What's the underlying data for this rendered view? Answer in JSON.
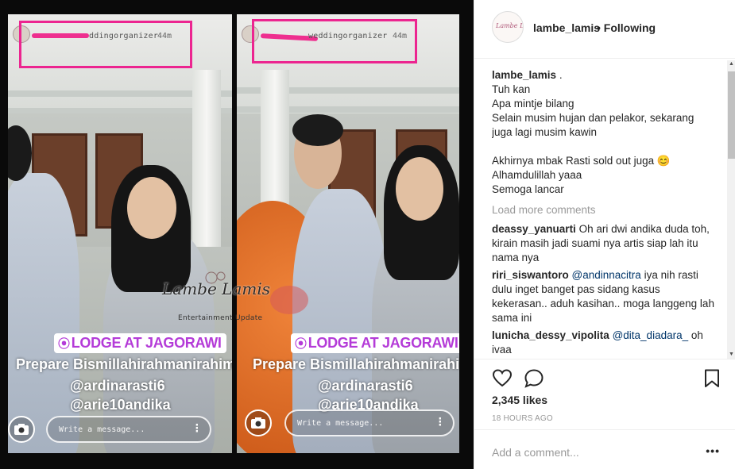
{
  "post": {
    "username": "lambe_lamis",
    "follow_status": "• Following",
    "avatar_text": "Lambe Lamis"
  },
  "caption": {
    "username": "lambe_lamis",
    "lines": [
      ".",
      "Tuh kan",
      "Apa mintje bilang",
      "Selain musim hujan dan pelakor, sekarang",
      "juga lagi musim kawin",
      "",
      "Akhirnya mbak Rasti sold out juga",
      "Alhamdulillah yaaa",
      "Semoga lancar"
    ],
    "emoji": "😊"
  },
  "load_more": "Load more comments",
  "comments": [
    {
      "user": "deassy_yanuarti",
      "mention": "",
      "text": "Oh ari dwi andika duda toh, kirain masih jadi suami nya artis siap lah itu nama nya"
    },
    {
      "user": "riri_siswantoro",
      "mention": "@andinnacitra",
      "text": "iya nih rasti dulu inget banget pas sidang kasus kekerasan.. aduh kasihan.. moga langgeng lah sama ini"
    },
    {
      "user": "lunicha_dessy_vipolita",
      "mention": "@dita_diadara_",
      "text": "oh ivaa"
    }
  ],
  "likes": "2,345 likes",
  "time_ago": "18 HOURS AGO",
  "add_comment_placeholder": "Add a comment...",
  "more_options": "•••",
  "story": {
    "left": {
      "user_suffix": "ddingorganizer",
      "time": "44m"
    },
    "right": {
      "user_suffix": "weddingorganizer",
      "time": "44m"
    },
    "location": "LODGE AT JAGORAWI",
    "prepare": "Prepare Bismillahirahmanirahim",
    "mention1": "@ardinarasti6",
    "mention2": "@arie10andika",
    "message_placeholder": "Write a message...",
    "watermark": "Lambe Lamis",
    "watermark_sub": "Entertainment Update"
  },
  "colors": {
    "highlight_box": "#ec2590",
    "location_text": "#b43bd8",
    "mention_link": "#003569"
  },
  "icons": [
    "heart-icon",
    "comment-icon",
    "bookmark-icon",
    "camera-icon",
    "more-vertical-icon",
    "location-pin-icon"
  ]
}
